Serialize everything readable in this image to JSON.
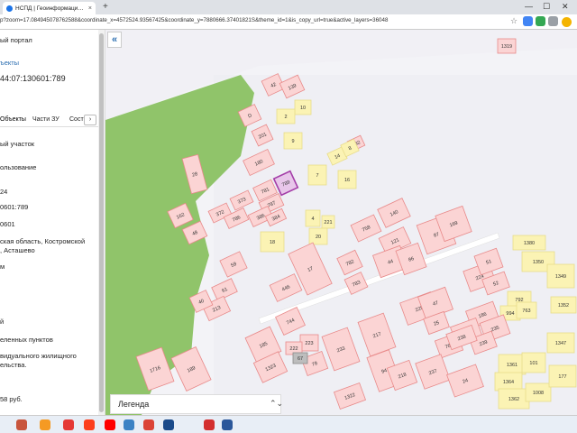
{
  "browser": {
    "tab_title": "НСПД | Геоинформационный п",
    "url": "p?zoom=17.084945078762588&coordinate_x=4572524.93567425&coordinate_y=7880666.37401821S&theme_id=1&is_copy_url=true&active_layers=36048",
    "new_tab": "+",
    "close_tab": "×",
    "minimize": "—",
    "maximize": "☐",
    "close_window": "✕",
    "star": "☆"
  },
  "sidebar": {
    "portal": "ый портал",
    "objects_link": "ъекты",
    "cadastral_number": "44:07:130601:789",
    "tabs": [
      "Объекты",
      "Части ЗУ",
      "Сост"
    ],
    "arrow": "›",
    "fields": [
      "ый участок",
      "ользование",
      "24",
      "0601:789",
      "0601",
      "ская область, Костромской",
      ", Асташево",
      "м",
      "й",
      "еленных пунктов",
      "видуального жилищного",
      "ельства.",
      "58 руб."
    ]
  },
  "map": {
    "collapse_button": "«",
    "legend_label": "Легенда",
    "legend_chevron": "⌃⌄",
    "highlighted_parcel": "789",
    "parcel_labels": [
      "42",
      "139",
      "10",
      "2",
      "D",
      "201",
      "9",
      "192",
      "14",
      "8",
      "180",
      "7",
      "16",
      "28",
      "789",
      "781",
      "373",
      "787",
      "372",
      "786",
      "386",
      "384",
      "162",
      "4",
      "221",
      "48",
      "20",
      "18",
      "140",
      "758",
      "121",
      "87",
      "169",
      "44",
      "86",
      "17",
      "782",
      "1380",
      "1350",
      "59",
      "783",
      "224",
      "51",
      "1349",
      "446",
      "52",
      "61",
      "225",
      "47",
      "792",
      "213",
      "40",
      "744",
      "25",
      "186",
      "994",
      "763",
      "1352",
      "217",
      "236",
      "235",
      "185",
      "223",
      "222",
      "233",
      "239",
      "764",
      "1347",
      "238",
      "1716",
      "189",
      "78",
      "94",
      "218",
      "237",
      "1361",
      "1323",
      "67",
      "24",
      "101",
      "1364",
      "1362",
      "1008",
      "1322",
      "177",
      "1319"
    ]
  },
  "taskbar": {
    "icons": [
      "antelope-app-icon",
      "ok-icon",
      "yandex-icon",
      "yandex-browser-icon",
      "youtube-icon",
      "app-icon",
      "chrome-icon",
      "firefox-icon",
      "app-icon-2",
      "word-icon"
    ]
  },
  "colors": {
    "parcel_fill": "#fbd4d4",
    "parcel_stroke": "#e88a8a",
    "yellow_fill": "#fbf3b4",
    "yellow_stroke": "#e8dc8a",
    "forest": "#90c46a",
    "highlight": "#a43ea8",
    "accent": "#2a6db0"
  }
}
